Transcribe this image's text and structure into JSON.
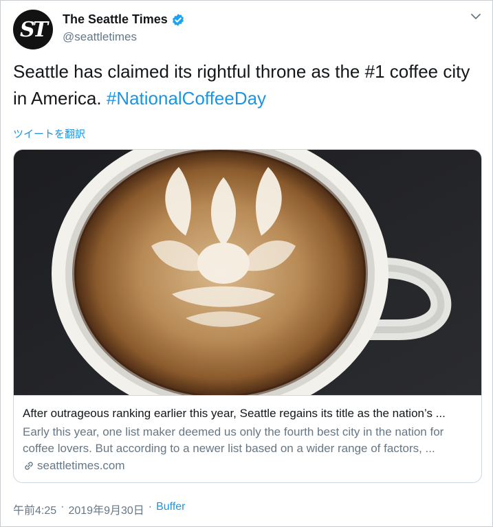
{
  "account": {
    "name": "The Seattle Times",
    "handle": "@seattletimes",
    "avatar_text": "ST"
  },
  "tweet": {
    "text": "Seattle has claimed its rightful throne as the #1 coffee city in America. ",
    "hashtag": "#NationalCoffeeDay",
    "translate_label": "ツイートを翻訳"
  },
  "card": {
    "image_subject": "latte art coffee cup",
    "title": "After outrageous ranking earlier this year, Seattle regains its title as the nation’s ...",
    "description": "Early this year, one list maker deemed us only the fourth best city in the nation for coffee lovers. But according to a newer list based on a wider range of factors, ...",
    "domain": "seattletimes.com"
  },
  "meta": {
    "time": "午前4:25",
    "separator": "·",
    "date": "2019年9月30日",
    "source": "Buffer"
  },
  "colors": {
    "link": "#1b95e0",
    "secondary": "#657786",
    "verified": "#1da1f2"
  },
  "icons": [
    "verified-badge-icon",
    "chevron-down-icon",
    "link-icon"
  ]
}
